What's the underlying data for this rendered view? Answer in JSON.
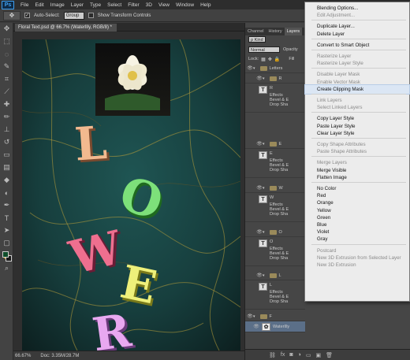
{
  "app": {
    "logo": "Ps"
  },
  "menu": [
    "File",
    "Edit",
    "Image",
    "Layer",
    "Type",
    "Select",
    "Filter",
    "3D",
    "View",
    "Window",
    "Help"
  ],
  "options": {
    "auto_select": "Auto-Select:",
    "auto_select_value": "Group",
    "show_transform": "Show Transform Controls"
  },
  "document": {
    "tab": "Floral Text.psd @ 66.7% (WaterlIly, RGB/8) *"
  },
  "status": {
    "zoom": "66.67%",
    "doc": "Doc: 3.35M/28.7M"
  },
  "panels": {
    "tabs": [
      "Channel",
      "History",
      "Layers",
      "Pa"
    ],
    "filter": "ρ Kind",
    "blend_mode": "Normal",
    "opacity_label": "Opacity",
    "lock_label": "Lock:",
    "fill_label": "Fill"
  },
  "layers": [
    {
      "name": "Letters"
    },
    {
      "name": "R"
    },
    {
      "name": "R",
      "effects": [
        "Effects",
        "Bevel & E",
        "Drop Sha"
      ]
    },
    {
      "name": "E"
    },
    {
      "name": "E",
      "effects": [
        "Effects",
        "Bevel & E",
        "Drop Sha"
      ]
    },
    {
      "name": "W"
    },
    {
      "name": "W",
      "effects": [
        "Effects",
        "Bevel & E",
        "Drop Sha"
      ]
    },
    {
      "name": "O"
    },
    {
      "name": "O",
      "effects": [
        "Effects",
        "Bevel & E",
        "Drop Sha"
      ]
    },
    {
      "name": "L"
    },
    {
      "name": "L",
      "effects": [
        "Effects",
        "Bevel & E",
        "Drop Sha"
      ]
    },
    {
      "name": "F"
    },
    {
      "name": "WaterlIly"
    }
  ],
  "context_menu": {
    "items": [
      {
        "label": "Blending Options...",
        "enabled": true
      },
      {
        "label": "Edit Adjustment...",
        "enabled": false
      },
      {
        "sep": true
      },
      {
        "label": "Duplicate Layer...",
        "enabled": true
      },
      {
        "label": "Delete Layer",
        "enabled": true
      },
      {
        "sep": true
      },
      {
        "label": "Convert to Smart Object",
        "enabled": true
      },
      {
        "sep": true
      },
      {
        "label": "Rasterize Layer",
        "enabled": false
      },
      {
        "label": "Rasterize Layer Style",
        "enabled": false
      },
      {
        "sep": true
      },
      {
        "label": "Disable Layer Mask",
        "enabled": false
      },
      {
        "label": "Enable Vector Mask",
        "enabled": false
      },
      {
        "label": "Create Clipping Mask",
        "enabled": true,
        "hover": true
      },
      {
        "sep": true
      },
      {
        "label": "Link Layers",
        "enabled": false
      },
      {
        "label": "Select Linked Layers",
        "enabled": false
      },
      {
        "sep": true
      },
      {
        "label": "Copy Layer Style",
        "enabled": true
      },
      {
        "label": "Paste Layer Style",
        "enabled": true
      },
      {
        "label": "Clear Layer Style",
        "enabled": true
      },
      {
        "sep": true
      },
      {
        "label": "Copy Shape Attributes",
        "enabled": false
      },
      {
        "label": "Paste Shape Attributes",
        "enabled": false
      },
      {
        "sep": true
      },
      {
        "label": "Merge Layers",
        "enabled": false
      },
      {
        "label": "Merge Visible",
        "enabled": true
      },
      {
        "label": "Flatten Image",
        "enabled": true
      },
      {
        "sep": true
      },
      {
        "label": "No Color",
        "enabled": true
      },
      {
        "label": "Red",
        "enabled": true
      },
      {
        "label": "Orange",
        "enabled": true
      },
      {
        "label": "Yellow",
        "enabled": true
      },
      {
        "label": "Green",
        "enabled": true
      },
      {
        "label": "Blue",
        "enabled": true
      },
      {
        "label": "Violet",
        "enabled": true
      },
      {
        "label": "Gray",
        "enabled": true
      },
      {
        "sep": true
      },
      {
        "label": "Postcard",
        "enabled": false
      },
      {
        "label": "New 3D Extrusion from Selected Layer",
        "enabled": false
      },
      {
        "label": "New 3D Extrusion",
        "enabled": false
      }
    ]
  }
}
